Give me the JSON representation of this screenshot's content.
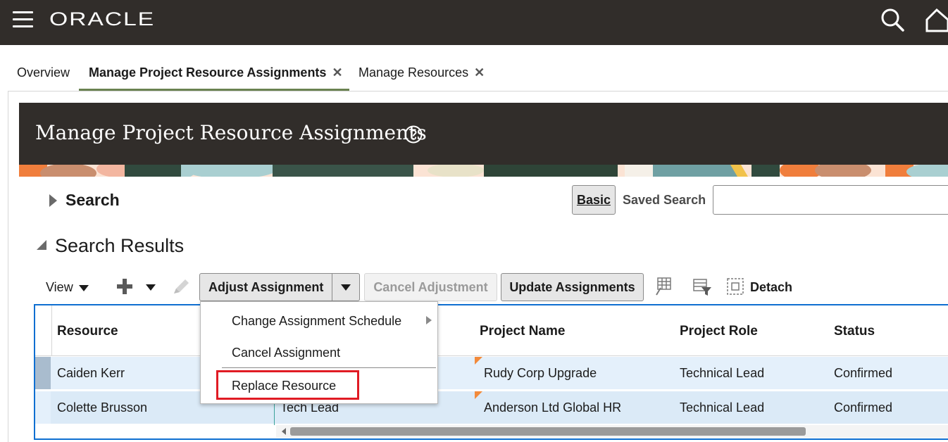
{
  "topbar": {
    "logo": "ORACLE",
    "menu_icon": "hamburger-icon",
    "search_icon": "search-icon",
    "home_icon": "home-icon"
  },
  "tabs": [
    {
      "label": "Overview",
      "active": false,
      "closable": false
    },
    {
      "label": "Manage Project Resource Assignments",
      "active": true,
      "closable": true
    },
    {
      "label": "Manage Resources",
      "active": false,
      "closable": true
    }
  ],
  "tab_close_glyph": "✕",
  "page": {
    "title": "Manage Project Resource Assignments",
    "help_icon": "help-icon"
  },
  "search": {
    "label": "Search",
    "basic_button": "Basic",
    "saved_search_label": "Saved Search",
    "saved_search_value": ""
  },
  "results": {
    "label": "Search Results"
  },
  "toolbar": {
    "view_label": "View",
    "add_icon": "plus-icon",
    "edit_icon": "pencil-icon",
    "adjust_assignment": "Adjust Assignment",
    "cancel_adjustment": "Cancel Adjustment",
    "update_assignments": "Update Assignments",
    "freeze_icon": "freeze-columns-icon",
    "filter_icon": "query-by-example-icon",
    "detach_icon": "detach-icon",
    "detach_label": "Detach"
  },
  "table": {
    "columns": [
      "Resource",
      "Project Name",
      "Project Role",
      "Status"
    ],
    "rows": [
      {
        "resource": "Caiden Kerr",
        "assignment": "",
        "project_name": "Rudy Corp Upgrade",
        "project_role": "Technical Lead",
        "status": "Confirmed"
      },
      {
        "resource": "Colette Brusson",
        "assignment": "Tech Lead",
        "project_name": "Anderson Ltd Global HR",
        "project_role": "Technical Lead",
        "status": "Confirmed"
      }
    ]
  },
  "adjust_menu": {
    "items": [
      "Change Assignment Schedule",
      "Cancel Assignment",
      "Replace Resource"
    ]
  },
  "colors": {
    "topbar": "#312d2a",
    "active_tab_underline": "#6a8251",
    "table_border": "#0f6fd1",
    "highlight": "#e01b24",
    "row_selected": "#e4f0fb"
  }
}
